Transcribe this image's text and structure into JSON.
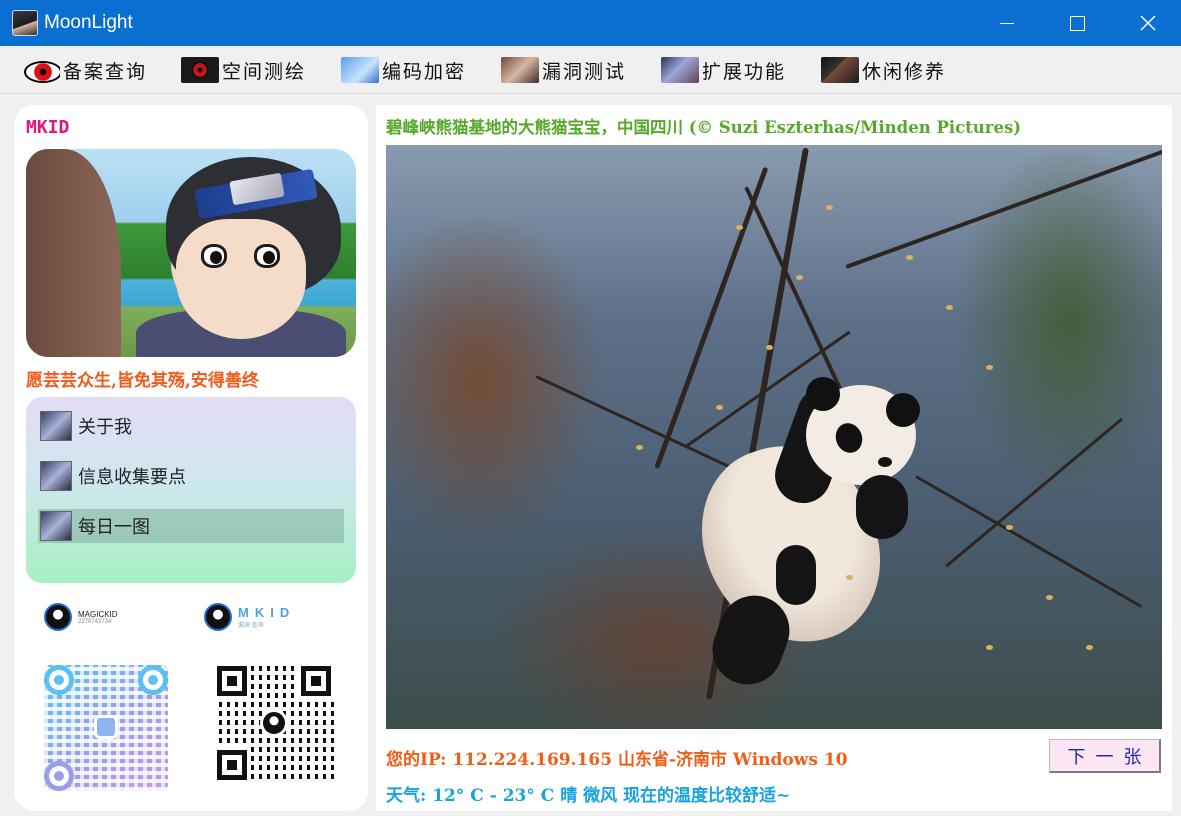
{
  "window": {
    "title": "MoonLight"
  },
  "toolbar": {
    "items": [
      {
        "label": "备案查询",
        "icon": "sharingan-eye-icon"
      },
      {
        "label": "空间测绘",
        "icon": "sharingan-icon"
      },
      {
        "label": "编码加密",
        "icon": "doraemon-icon"
      },
      {
        "label": "漏洞测试",
        "icon": "anime-eye-portrait-icon"
      },
      {
        "label": "扩展功能",
        "icon": "anime-portrait-icon"
      },
      {
        "label": "休闲修养",
        "icon": "ninja-portrait-icon"
      }
    ]
  },
  "sidebar": {
    "brand": "MKID",
    "motto": "愿芸芸众生,皆免其殇,安得善终",
    "menu": [
      {
        "label": "关于我",
        "active": false
      },
      {
        "label": "信息收集要点",
        "active": false
      },
      {
        "label": "每日一图",
        "active": true
      }
    ],
    "qq_card": {
      "name": "MAGICKID",
      "number": "2270743734"
    },
    "group_card": {
      "logo": "MKID",
      "sub": "漏洞 查询"
    }
  },
  "main": {
    "caption": "碧峰峡熊猫基地的大熊猫宝宝，中国四川 (© Suzi Eszterhas/Minden Pictures)",
    "ip_line": "您的IP: 112.224.169.165 山东省-济南市 Windows 10",
    "weather_line": "天气: 12° C - 23° C 晴 微风 现在的温度比较舒适~",
    "next_button": "下一张"
  },
  "colors": {
    "titlebar": "#0a6fd0",
    "brand": "#e0167f",
    "motto": "#f05a1a",
    "caption": "#58a82b",
    "ip": "#f25c14",
    "weather": "#16a3e0",
    "next_text": "#1a2bb0"
  }
}
